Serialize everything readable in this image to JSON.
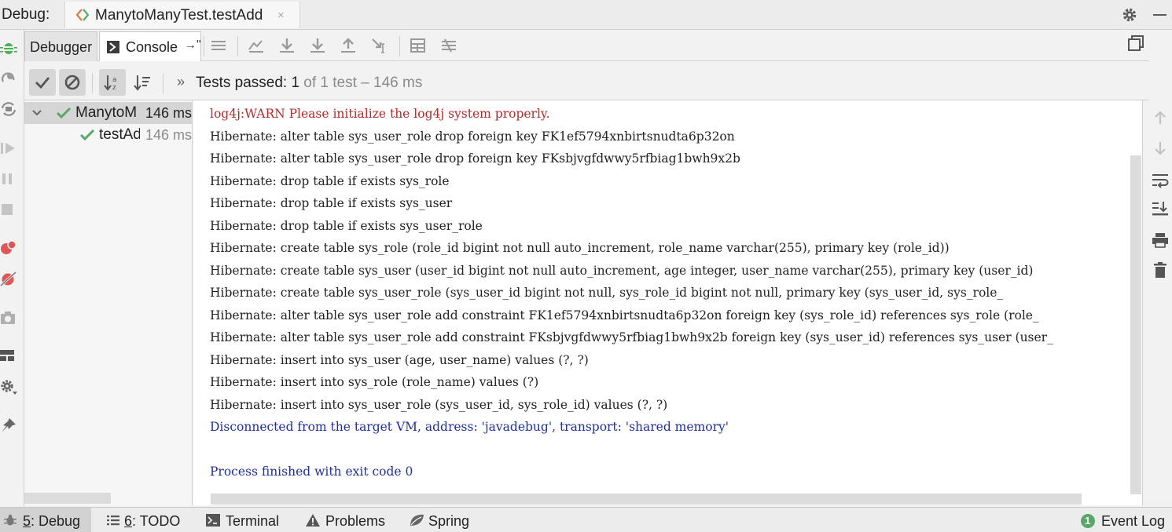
{
  "titlebar": {
    "label": "Debug:",
    "tab_title": "ManytoManyTest.testAdd",
    "close_glyph": "×"
  },
  "tabs": {
    "debugger": "Debugger",
    "console": "Console",
    "console_pin": "→\""
  },
  "testbar": {
    "chevron": "»",
    "status_prefix": "Tests passed: ",
    "passed_count": "1",
    "status_suffix": " of 1 test – 146 ms"
  },
  "tree": [
    {
      "name": "ManytoM",
      "time": "146 ms",
      "expanded": true
    },
    {
      "name": "testAd",
      "time": "146 ms"
    }
  ],
  "console": {
    "lines": [
      {
        "text": "log4j:WARN Please initialize the log4j system properly.",
        "kind": "warn"
      },
      {
        "text": "Hibernate: alter table sys_user_role drop foreign key FK1ef5794xnbirtsnudta6p32on",
        "kind": "normal"
      },
      {
        "text": "Hibernate: alter table sys_user_role drop foreign key FKsbjvgfdwwy5rfbiag1bwh9x2b",
        "kind": "normal"
      },
      {
        "text": "Hibernate: drop table if exists sys_role",
        "kind": "normal"
      },
      {
        "text": "Hibernate: drop table if exists sys_user",
        "kind": "normal"
      },
      {
        "text": "Hibernate: drop table if exists sys_user_role",
        "kind": "normal"
      },
      {
        "text": "Hibernate: create table sys_role (role_id bigint not null auto_increment, role_name varchar(255), primary key (role_id))",
        "kind": "normal"
      },
      {
        "text": "Hibernate: create table sys_user (user_id bigint not null auto_increment, age integer, user_name varchar(255), primary key (user_id)",
        "kind": "normal"
      },
      {
        "text": "Hibernate: create table sys_user_role (sys_user_id bigint not null, sys_role_id bigint not null, primary key (sys_user_id, sys_role_",
        "kind": "normal"
      },
      {
        "text": "Hibernate: alter table sys_user_role add constraint FK1ef5794xnbirtsnudta6p32on foreign key (sys_role_id) references sys_role (role_",
        "kind": "normal"
      },
      {
        "text": "Hibernate: alter table sys_user_role add constraint FKsbjvgfdwwy5rfbiag1bwh9x2b foreign key (sys_user_id) references sys_user (user_",
        "kind": "normal"
      },
      {
        "text": "Hibernate: insert into sys_user (age, user_name) values (?, ?)",
        "kind": "normal"
      },
      {
        "text": "Hibernate: insert into sys_role (role_name) values (?)",
        "kind": "normal"
      },
      {
        "text": "Hibernate: insert into sys_user_role (sys_user_id, sys_role_id) values (?, ?)",
        "kind": "normal"
      },
      {
        "text": "Disconnected from the target VM, address: 'javadebug', transport: 'shared memory'",
        "kind": "sys"
      },
      {
        "text": "",
        "kind": "blank"
      },
      {
        "text": "Process finished with exit code 0",
        "kind": "sys"
      }
    ]
  },
  "bottombar": {
    "debug_num": "5",
    "debug_label": ": Debug",
    "todo_num": "6",
    "todo_label": ": TODO",
    "terminal": "Terminal",
    "problems": "Problems",
    "spring": "Spring",
    "event_count": "1",
    "event_log": "Event Log"
  },
  "colors": {
    "pass_green": "#59a869",
    "warn_red": "#b52a2a",
    "sys_blue": "#1f2fa0",
    "debug_green": "#4caf50",
    "breakpoint_red": "#e05555"
  },
  "icons": {
    "titlebar": [
      "diamond-icon",
      "gear-icon",
      "minimize-icon"
    ],
    "left_toolbar": [
      "rerun-debug-icon",
      "rerun-failed-icon",
      "restore-layout-icon",
      "resume-icon",
      "pause-icon",
      "stop-icon",
      "view-breakpoints-icon",
      "mute-breakpoints-icon",
      "camera-icon",
      "layout-icon",
      "settings-icon",
      "pin-icon"
    ],
    "console_toolbar": [
      "menu-icon",
      "show-execution-point-icon",
      "step-over-icon",
      "step-into-icon",
      "step-out-icon",
      "run-to-cursor-icon",
      "evaluate-icon",
      "trace-icon"
    ],
    "gutter": [
      "up-arrow-icon",
      "down-arrow-icon",
      "soft-wrap-icon",
      "scroll-to-end-icon",
      "print-icon",
      "trash-icon"
    ]
  }
}
